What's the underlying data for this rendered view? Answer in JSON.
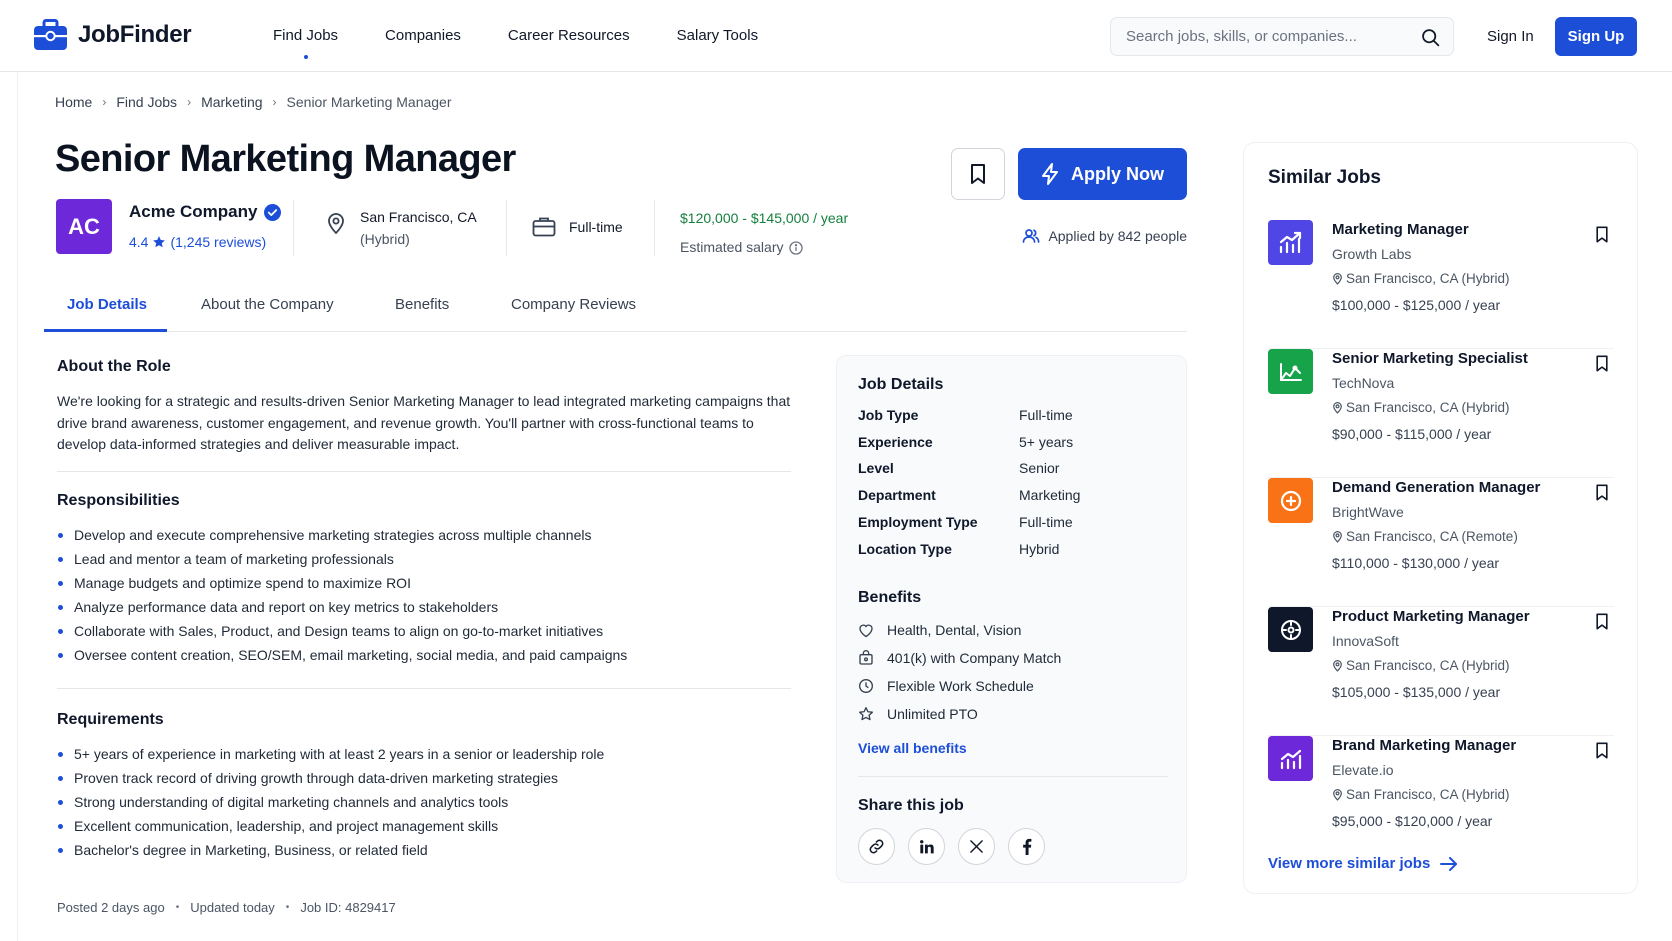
{
  "brand": {
    "name": "JobFinder",
    "accent": "#1d4ed8"
  },
  "nav": [
    {
      "label": "Find Jobs",
      "active": true
    },
    {
      "label": "Companies"
    },
    {
      "label": "Career Resources"
    },
    {
      "label": "Salary Tools"
    }
  ],
  "search": {
    "placeholder": "Search jobs, skills, or companies...",
    "value": ""
  },
  "auth": {
    "sign_in": "Sign In",
    "sign_up": "Sign Up"
  },
  "breadcrumb": [
    "Home",
    "Find Jobs",
    "Marketing",
    "Senior Marketing Manager"
  ],
  "job": {
    "title": "Senior Marketing Manager",
    "company": {
      "initials": "AC",
      "name": "Acme Company",
      "rating": "4.4",
      "reviews": "(1,245 reviews)",
      "logo_color": "#6d28d9"
    },
    "location": "San Francisco, CA",
    "location_mode": "(Hybrid)",
    "type": "Full-time",
    "salary": "$120,000 - $145,000 / year",
    "salary_note": "Estimated salary",
    "apply_label": "Apply Now",
    "applied": "Applied by 842 people"
  },
  "tabs": [
    "Job Details",
    "About the Company",
    "Benefits",
    "Company Reviews"
  ],
  "about": {
    "heading": "About the Role",
    "text": "We're looking for a strategic and results-driven Senior Marketing Manager to lead integrated marketing campaigns that drive brand awareness, customer engagement, and revenue growth. You'll partner with cross-functional teams to develop data-informed strategies and deliver measurable impact."
  },
  "responsibilities": {
    "heading": "Responsibilities",
    "items": [
      "Develop and execute comprehensive marketing strategies across multiple channels",
      "Lead and mentor a team of marketing professionals",
      "Manage budgets and optimize spend to maximize ROI",
      "Analyze performance data and report on key metrics to stakeholders",
      "Collaborate with Sales, Product, and Design teams to align on go-to-market initiatives",
      "Oversee content creation, SEO/SEM, email marketing, social media, and paid campaigns"
    ]
  },
  "requirements": {
    "heading": "Requirements",
    "items": [
      "5+ years of experience in marketing with at least 2 years in a senior or leadership role",
      "Proven track record of driving growth through data-driven marketing strategies",
      "Strong understanding of digital marketing channels and analytics tools",
      "Excellent communication, leadership, and project management skills",
      "Bachelor's degree in Marketing, Business, or related field"
    ]
  },
  "footer_meta": [
    "Posted 2 days ago",
    "Updated today",
    "Job ID: 4829417"
  ],
  "details_card": {
    "heading": "Job Details",
    "rows": [
      {
        "label": "Job Type",
        "value": "Full-time"
      },
      {
        "label": "Experience",
        "value": "5+ years"
      },
      {
        "label": "Level",
        "value": "Senior"
      },
      {
        "label": "Department",
        "value": "Marketing"
      },
      {
        "label": "Employment Type",
        "value": "Full-time"
      },
      {
        "label": "Location Type",
        "value": "Hybrid"
      }
    ],
    "benefits_heading": "Benefits",
    "benefits": [
      {
        "icon": "heart-icon",
        "label": "Health, Dental, Vision"
      },
      {
        "icon": "piggy-bank-icon",
        "label": "401(k) with Company Match"
      },
      {
        "icon": "clock-icon",
        "label": "Flexible Work Schedule"
      },
      {
        "icon": "star-icon",
        "label": "Unlimited PTO"
      }
    ],
    "view_benefits": "View all benefits",
    "share_heading": "Share this job",
    "share": [
      "link-icon",
      "linkedin-icon",
      "x-icon",
      "facebook-icon"
    ]
  },
  "similar": {
    "heading": "Similar Jobs",
    "jobs": [
      {
        "title": "Marketing Manager",
        "company": "Growth Labs",
        "location": "San Francisco, CA (Hybrid)",
        "salary": "$100,000 - $125,000 / year",
        "color": "#4f46e5",
        "icon": "growth-chart-icon"
      },
      {
        "title": "Senior Marketing Specialist",
        "company": "TechNova",
        "location": "San Francisco, CA (Hybrid)",
        "salary": "$90,000 - $115,000 / year",
        "color": "#16a34a",
        "icon": "analytics-icon"
      },
      {
        "title": "Demand Generation Manager",
        "company": "BrightWave",
        "location": "San Francisco, CA (Remote)",
        "salary": "$110,000 - $130,000 / year",
        "color": "#f97316",
        "icon": "target-icon"
      },
      {
        "title": "Product Marketing Manager",
        "company": "InnovaSoft",
        "location": "San Francisco, CA (Hybrid)",
        "salary": "$105,000 - $135,000 / year",
        "color": "#0f172a",
        "icon": "compass-icon"
      },
      {
        "title": "Brand Marketing Manager",
        "company": "Elevate.io",
        "location": "San Francisco, CA (Hybrid)",
        "salary": "$95,000 - $120,000 / year",
        "color": "#6d28d9",
        "icon": "bar-chart-icon"
      }
    ],
    "view_more": "View more similar jobs"
  }
}
